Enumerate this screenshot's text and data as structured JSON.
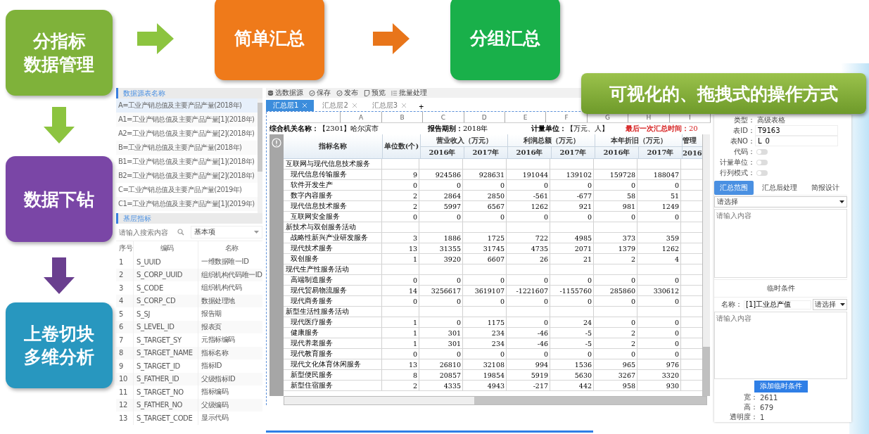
{
  "callouts": [
    {
      "lines": [
        "分指标",
        "数据管理"
      ],
      "color": "#7fb23a"
    },
    {
      "lines": [
        "简单汇总"
      ],
      "color": "#ef7a1a"
    },
    {
      "lines": [
        "分组汇总"
      ],
      "color": "#19b04a"
    },
    {
      "lines": [
        "数据下钻"
      ],
      "color": "#7a46a6"
    },
    {
      "lines": [
        "上卷切块",
        "多维分析"
      ],
      "color": "#2897bf"
    }
  ],
  "banner": "可视化的、拖拽式的操作方式",
  "source_panel": {
    "title": "数据源表名称",
    "items": [
      {
        "label": "A=工业产销总值及主要产品产量(2018年)",
        "selected": true
      },
      {
        "label": "A1=工业产销总值及主要产品产量[1](2018年)",
        "selected": false
      },
      {
        "label": "A2=工业产销总值及主要产品产量[2](2018年)",
        "selected": false
      },
      {
        "label": "B=工业产销总值及主要产品产量(2018年)",
        "selected": false
      },
      {
        "label": "B1=工业产销总值及主要产品产量[1](2018年)",
        "selected": false
      },
      {
        "label": "B2=工业产销总值及主要产品产量[2](2018年)",
        "selected": false
      },
      {
        "label": "C=工业产销总值及主要产品产量(2019年)",
        "selected": false
      },
      {
        "label": "C1=工业产销总值及主要产品产量[1](2019年)",
        "selected": false
      }
    ]
  },
  "indicator_panel": {
    "title": "基层指标",
    "search_placeholder": "请输入搜索内容",
    "filter": "基本项",
    "columns": [
      "序号",
      "编码",
      "名称"
    ],
    "rows": [
      [
        "1",
        "S_UUID",
        "一维数据唯一ID"
      ],
      [
        "2",
        "S_CORP_UUID",
        "组织机构代码唯一ID"
      ],
      [
        "3",
        "S_CODE",
        "组织机构代码"
      ],
      [
        "4",
        "S_CORP_CD",
        "数据处理地"
      ],
      [
        "5",
        "S_SJ",
        "报告期"
      ],
      [
        "6",
        "S_LEVEL_ID",
        "报表页"
      ],
      [
        "7",
        "S_TARGET_SY",
        "元指标编码"
      ],
      [
        "8",
        "S_TARGET_NAME",
        "指标名称"
      ],
      [
        "9",
        "S_TARGET_ID",
        "指标ID"
      ],
      [
        "10",
        "S_FATHER_ID",
        "父级指标ID"
      ],
      [
        "11",
        "S_TARGET_NO",
        "指标编码"
      ],
      [
        "12",
        "S_FATHER_NO",
        "父级编码"
      ],
      [
        "13",
        "S_TARGET_CODE",
        "显示代码"
      ]
    ]
  },
  "toolbar": [
    {
      "kind": "datasource",
      "label": "选数据源"
    },
    {
      "kind": "save",
      "label": "保存"
    },
    {
      "kind": "publish",
      "label": "发布"
    },
    {
      "kind": "preview",
      "label": "预览"
    },
    {
      "kind": "batch",
      "label": "批量处理"
    }
  ],
  "tabs": [
    {
      "label": "汇总层1",
      "selected": true
    },
    {
      "label": "汇总层2",
      "selected": false
    },
    {
      "label": "汇总层3",
      "selected": false
    }
  ],
  "add_tab": "+",
  "column_letters": [
    "A",
    "B",
    "C",
    "D",
    "E",
    "F",
    "G",
    "H",
    "I"
  ],
  "report_info": [
    {
      "kind": "normal",
      "label": "综合机关名称：",
      "value": "【2301】哈尔滨市"
    },
    {
      "kind": "normal",
      "label": "报告期别：",
      "value": "2018年"
    },
    {
      "kind": "normal",
      "label": "计量单位：",
      "value": "【万元、人】"
    },
    {
      "kind": "alert",
      "label": "最后一次汇总时间：",
      "value": "20"
    }
  ],
  "table": {
    "name_header": "指标名称",
    "count_header": "单位数(个)",
    "groups": [
      {
        "label": "营业收入（万元）",
        "years": [
          "2016年",
          "2017年"
        ]
      },
      {
        "label": "利润总额（万元）",
        "years": [
          "2016年",
          "2017年"
        ]
      },
      {
        "label": "本年折旧（万元）",
        "years": [
          "2016年",
          "2017年"
        ]
      },
      {
        "label": "管理",
        "years": [
          "2016"
        ]
      }
    ],
    "rows": [
      {
        "kind": "section",
        "name": "互联网与现代信息技术服务"
      },
      {
        "kind": "item",
        "name": "现代信息传输服务",
        "values": [
          "9",
          "924586",
          "928631",
          "191044",
          "139102",
          "159728",
          "188047"
        ]
      },
      {
        "kind": "item",
        "name": "软件开发生产",
        "values": [
          "0",
          "0",
          "0",
          "0",
          "0",
          "0",
          "0"
        ]
      },
      {
        "kind": "item",
        "name": "数字内容服务",
        "values": [
          "2",
          "2864",
          "2850",
          "-561",
          "-677",
          "58",
          "51"
        ]
      },
      {
        "kind": "item",
        "name": "现代信息技术服务",
        "values": [
          "2",
          "5997",
          "6567",
          "1262",
          "921",
          "981",
          "1249"
        ]
      },
      {
        "kind": "item",
        "name": "互联网安全服务",
        "values": [
          "0",
          "0",
          "0",
          "0",
          "0",
          "0",
          "0"
        ]
      },
      {
        "kind": "section",
        "name": "新技术与双创服务活动"
      },
      {
        "kind": "item",
        "name": "战略性新兴产业研发服务",
        "values": [
          "3",
          "1886",
          "1725",
          "722",
          "4985",
          "373",
          "359"
        ]
      },
      {
        "kind": "item",
        "name": "现代技术服务",
        "values": [
          "13",
          "31355",
          "31745",
          "4735",
          "2071",
          "1379",
          "1262"
        ]
      },
      {
        "kind": "item",
        "name": "双创服务",
        "values": [
          "1",
          "3920",
          "6607",
          "26",
          "21",
          "2",
          "4"
        ]
      },
      {
        "kind": "section",
        "name": "现代生产性服务活动"
      },
      {
        "kind": "item",
        "name": "高端制造服务",
        "values": [
          "0",
          "0",
          "0",
          "0",
          "0",
          "0",
          "0"
        ]
      },
      {
        "kind": "item",
        "name": "现代贸易物流服务",
        "values": [
          "14",
          "3256617",
          "3619107",
          "-1221607",
          "-1155760",
          "285860",
          "330612"
        ]
      },
      {
        "kind": "item",
        "name": "现代商务服务",
        "values": [
          "0",
          "0",
          "0",
          "0",
          "0",
          "0",
          "0"
        ]
      },
      {
        "kind": "section",
        "name": "新型生活性服务活动"
      },
      {
        "kind": "item",
        "name": "现代医疗服务",
        "values": [
          "1",
          "0",
          "1175",
          "0",
          "24",
          "0",
          "0"
        ]
      },
      {
        "kind": "item",
        "name": "健康服务",
        "values": [
          "1",
          "301",
          "234",
          "-46",
          "-5",
          "2",
          "0"
        ]
      },
      {
        "kind": "item",
        "name": "现代养老服务",
        "values": [
          "1",
          "301",
          "234",
          "-46",
          "-5",
          "2",
          "0"
        ]
      },
      {
        "kind": "item",
        "name": "现代教育服务",
        "values": [
          "0",
          "0",
          "0",
          "0",
          "0",
          "0",
          "0"
        ]
      },
      {
        "kind": "item",
        "name": "现代文化体育休闲服务",
        "values": [
          "13",
          "26810",
          "32108",
          "994",
          "1536",
          "965",
          "976"
        ]
      },
      {
        "kind": "item",
        "name": "新型便民服务",
        "values": [
          "8",
          "20857",
          "19854",
          "5919",
          "5630",
          "3267",
          "3320"
        ]
      },
      {
        "kind": "item",
        "name": "新型住宿服务",
        "values": [
          "2",
          "4335",
          "4943",
          "-217",
          "442",
          "958",
          "930"
        ]
      }
    ]
  },
  "properties": {
    "fields": [
      {
        "kind": "text",
        "label": "类型：",
        "value": "高级表格"
      },
      {
        "kind": "input",
        "label": "表ID：",
        "value": "T9163"
      },
      {
        "kind": "input",
        "label": "表NO：",
        "value": "L_0"
      },
      {
        "kind": "toggle",
        "label": "代码：",
        "on": false
      },
      {
        "kind": "toggle",
        "label": "计量单位：",
        "on": false
      },
      {
        "kind": "toggle",
        "label": "行列模式：",
        "on": false
      }
    ],
    "tabs": [
      {
        "label": "汇总范围",
        "selected": true
      },
      {
        "label": "汇总后处理",
        "selected": false
      },
      {
        "label": "简报设计",
        "selected": false
      }
    ],
    "scope_select": "请选择",
    "scope_placeholder": "请输入内容",
    "temp_title": "临时条件",
    "name_label": "名称：",
    "name_value": "[1]工业总产值",
    "name_select": "请选择",
    "condition_placeholder": "请输入内容",
    "add_button": "添加临时条件",
    "size": [
      {
        "label": "宽：",
        "value": "2611"
      },
      {
        "label": "高：",
        "value": "679"
      },
      {
        "label": "透明度：",
        "value": "1"
      }
    ]
  }
}
